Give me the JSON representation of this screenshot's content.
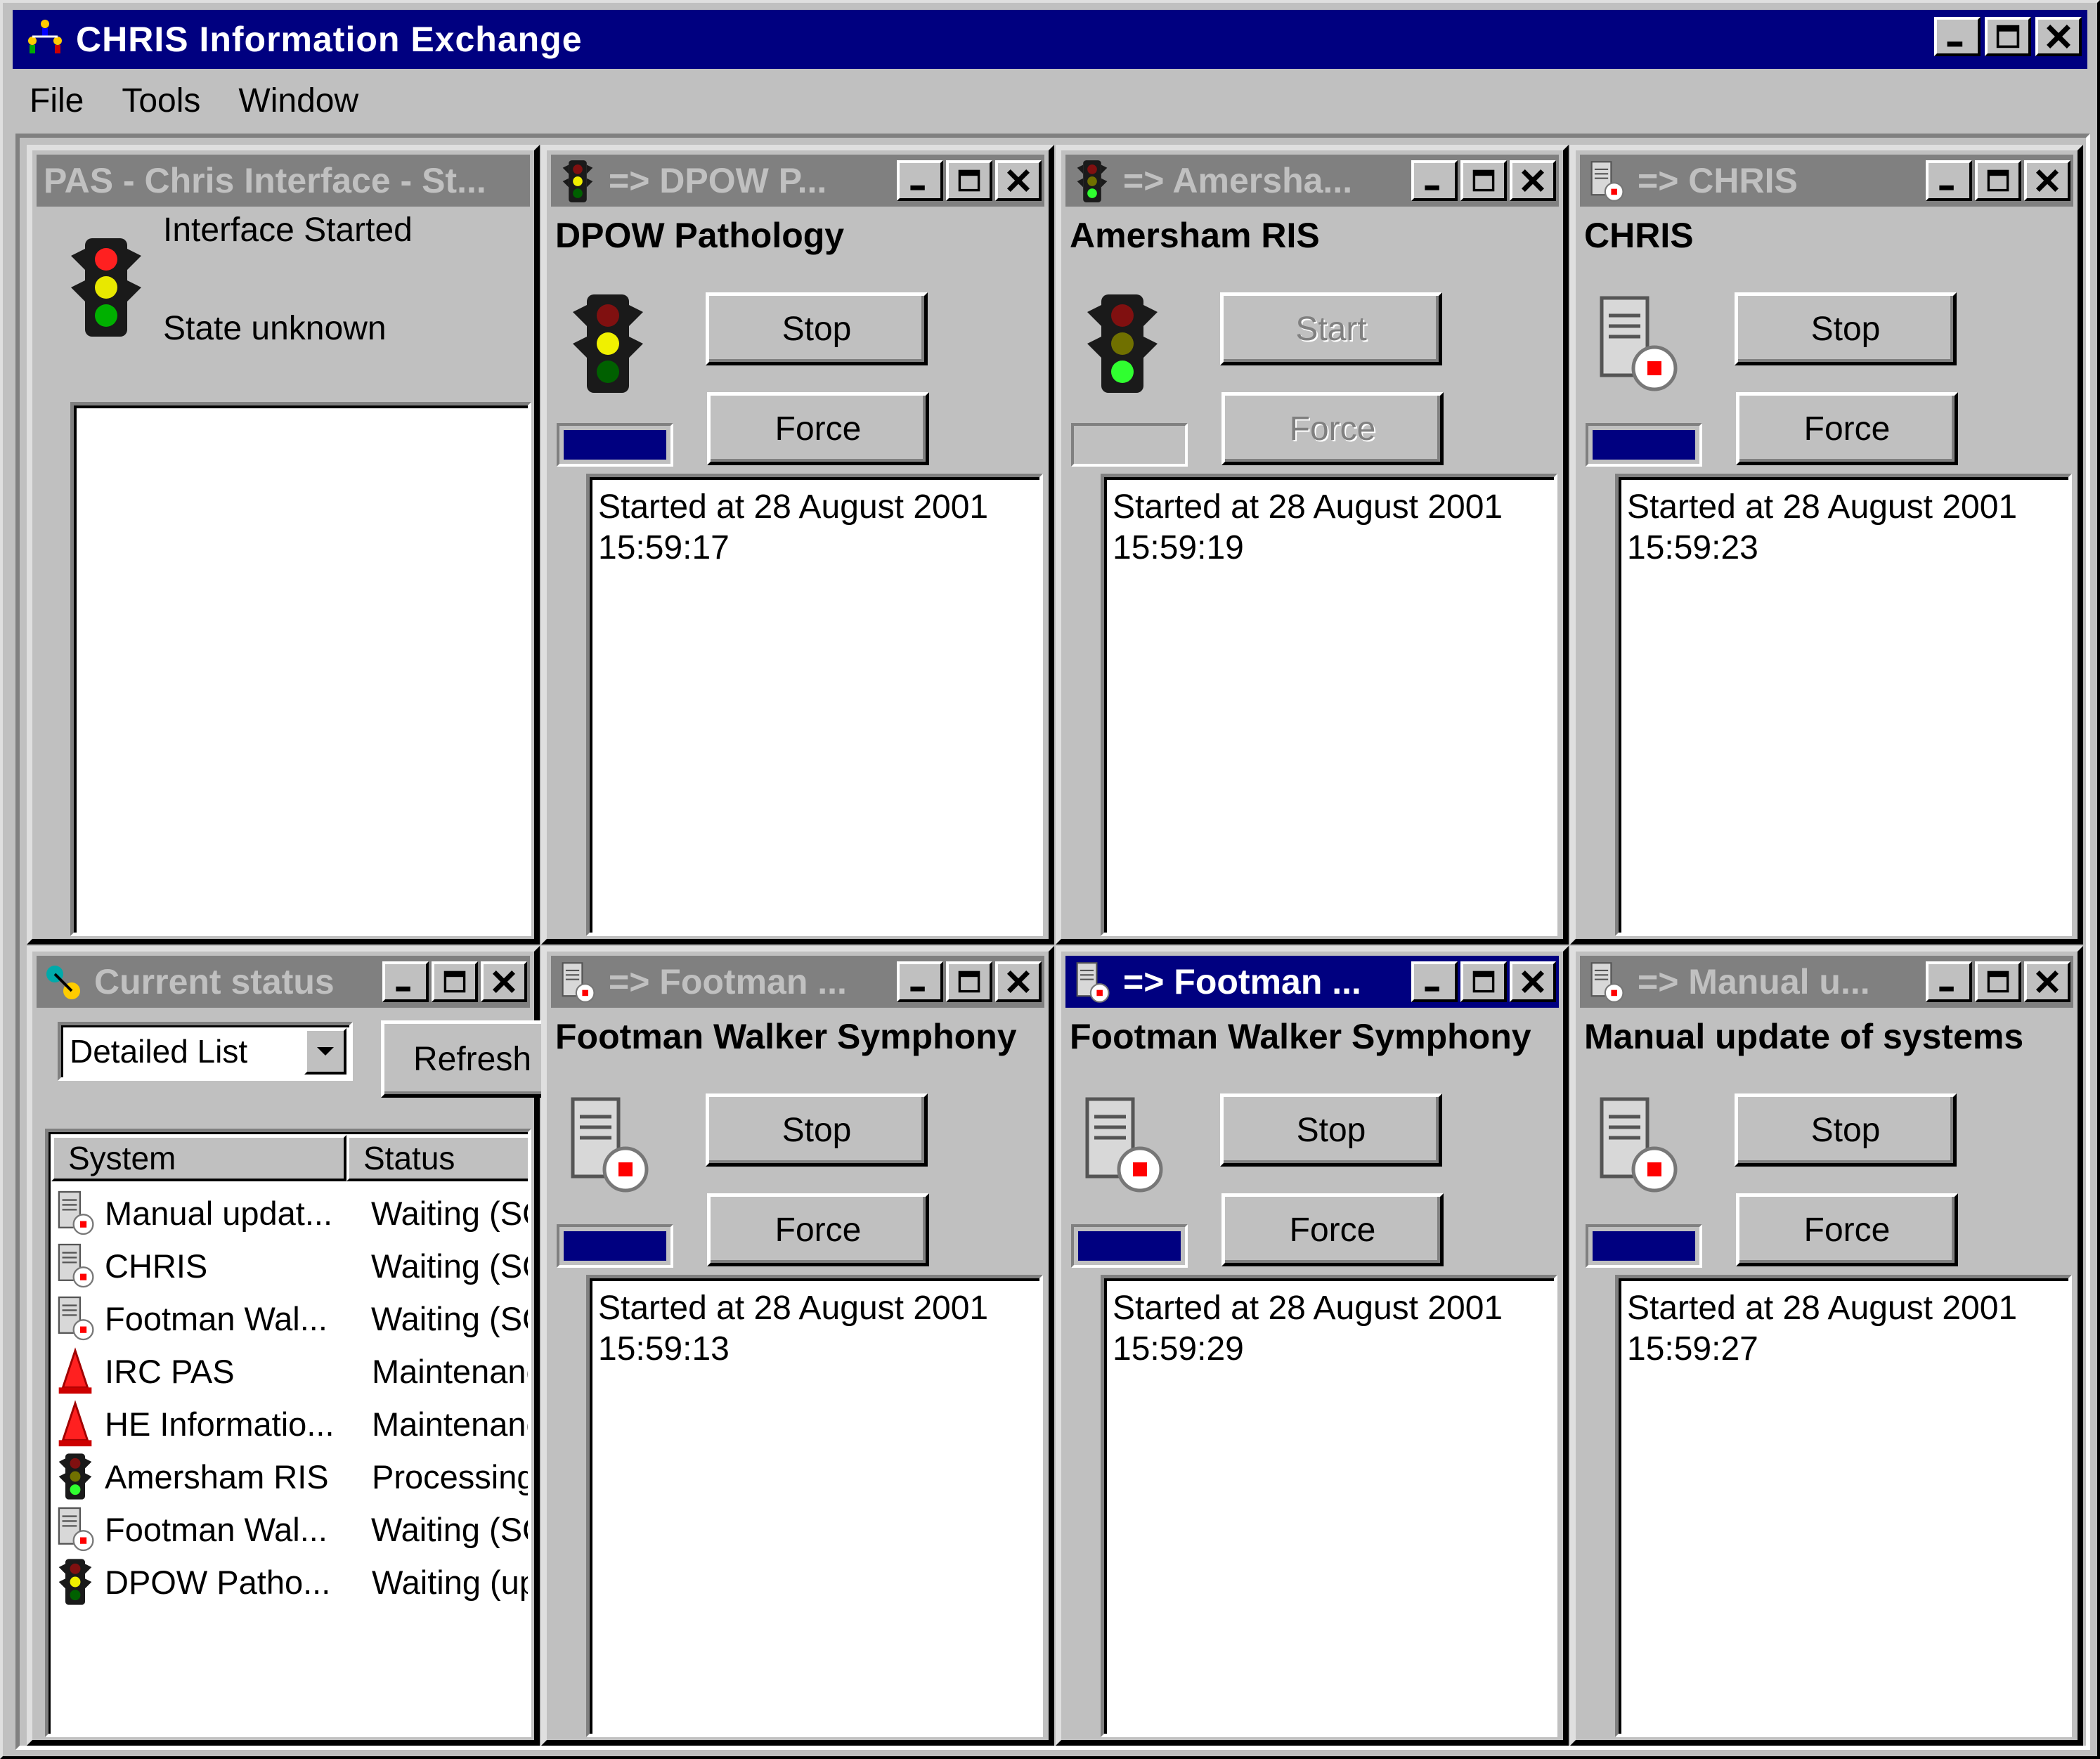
{
  "app": {
    "title": "CHRIS Information Exchange",
    "menu": [
      "File",
      "Tools",
      "Window"
    ]
  },
  "pas_window": {
    "title": "PAS - Chris Interface - St...",
    "status_line1": "Interface Started",
    "status_line2": "State unknown"
  },
  "status_window": {
    "title": "Current status",
    "view_select": "Detailed List",
    "refresh_label": "Refresh",
    "columns": [
      "System",
      "Status"
    ],
    "rows": [
      {
        "system": "Manual updat...",
        "status": "Waiting (SC",
        "icon": "server-stop-icon"
      },
      {
        "system": "CHRIS",
        "status": "Waiting (SC",
        "icon": "server-stop-icon"
      },
      {
        "system": "Footman Wal...",
        "status": "Waiting (SC",
        "icon": "server-stop-icon"
      },
      {
        "system": "IRC PAS",
        "status": "Maintenanc",
        "icon": "warning-cone-icon"
      },
      {
        "system": "HE Informatio...",
        "status": "Maintenanc",
        "icon": "warning-cone-icon"
      },
      {
        "system": "Amersham RIS",
        "status": "Processing",
        "icon": "traffic-light-green-icon"
      },
      {
        "system": "Footman Wal...",
        "status": "Waiting (SC",
        "icon": "server-stop-icon"
      },
      {
        "system": "DPOW Patho...",
        "status": "Waiting (up",
        "icon": "traffic-light-yellow-icon"
      }
    ]
  },
  "windows": [
    {
      "title": "=> DPOW P...",
      "name": "DPOW Pathology",
      "button1": "Stop",
      "button2": "Force",
      "log_line1": "Started at 28 August 2001",
      "log_line2": "15:59:17"
    },
    {
      "title": "=> Amersha...",
      "name": "Amersham RIS",
      "button1": "Start",
      "button2": "Force",
      "log_line1": "Started at 28 August 2001",
      "log_line2": "15:59:19"
    },
    {
      "title": "=> CHRIS",
      "name": "CHRIS",
      "button1": "Stop",
      "button2": "Force",
      "log_line1": "Started at 28 August 2001",
      "log_line2": "15:59:23"
    },
    {
      "title": "=> Footman ...",
      "name": "Footman Walker Symphony",
      "button1": "Stop",
      "button2": "Force",
      "log_line1": "Started at 28 August 2001",
      "log_line2": "15:59:13"
    },
    {
      "title": "=> Footman ...",
      "name": "Footman Walker Symphony",
      "button1": "Stop",
      "button2": "Force",
      "log_line1": "Started at 28 August 2001",
      "log_line2": "15:59:29"
    },
    {
      "title": "=> Manual u...",
      "name": "Manual update of systems",
      "button1": "Stop",
      "button2": "Force",
      "log_line1": "Started at 28 August 2001",
      "log_line2": "15:59:27"
    }
  ],
  "colors": {
    "active_title": "#000080",
    "inactive_title": "#808080",
    "face": "#c0c0c0",
    "progress": "#000080"
  }
}
